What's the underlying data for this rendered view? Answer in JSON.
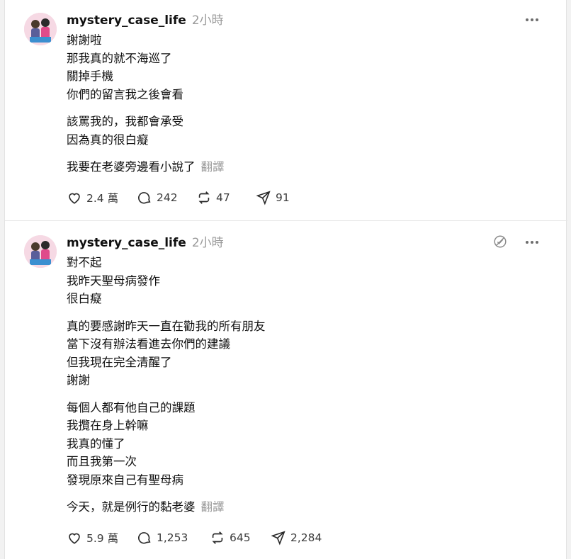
{
  "posts": [
    {
      "username": "mystery_case_life",
      "time": "2小時",
      "paragraphs": [
        [
          "謝謝啦",
          "那我真的就不海巡了",
          "關掉手機",
          "你們的留言我之後會看"
        ],
        [
          "該罵我的，我都會承受",
          "因為真的很白癡"
        ],
        [
          "我要在老婆旁邊看小說了"
        ]
      ],
      "translate": "翻譯",
      "likes": "2.4 萬",
      "comments": "242",
      "reposts": "47",
      "shares": "91"
    },
    {
      "username": "mystery_case_life",
      "time": "2小時",
      "paragraphs": [
        [
          "對不起",
          "我昨天聖母病發作",
          "很白癡"
        ],
        [
          "真的要感謝昨天一直在勸我的所有朋友",
          "當下沒有辦法看進去你們的建議",
          "但我現在完全清醒了",
          "謝謝"
        ],
        [
          "每個人都有他自己的課題",
          "我攬在身上幹嘛",
          "我真的懂了",
          "而且我第一次",
          "發現原來自己有聖母病"
        ],
        [
          "今天，就是例行的黏老婆"
        ]
      ],
      "translate": "翻譯",
      "likes": "5.9 萬",
      "comments": "1,253",
      "reposts": "645",
      "shares": "2,284"
    }
  ]
}
